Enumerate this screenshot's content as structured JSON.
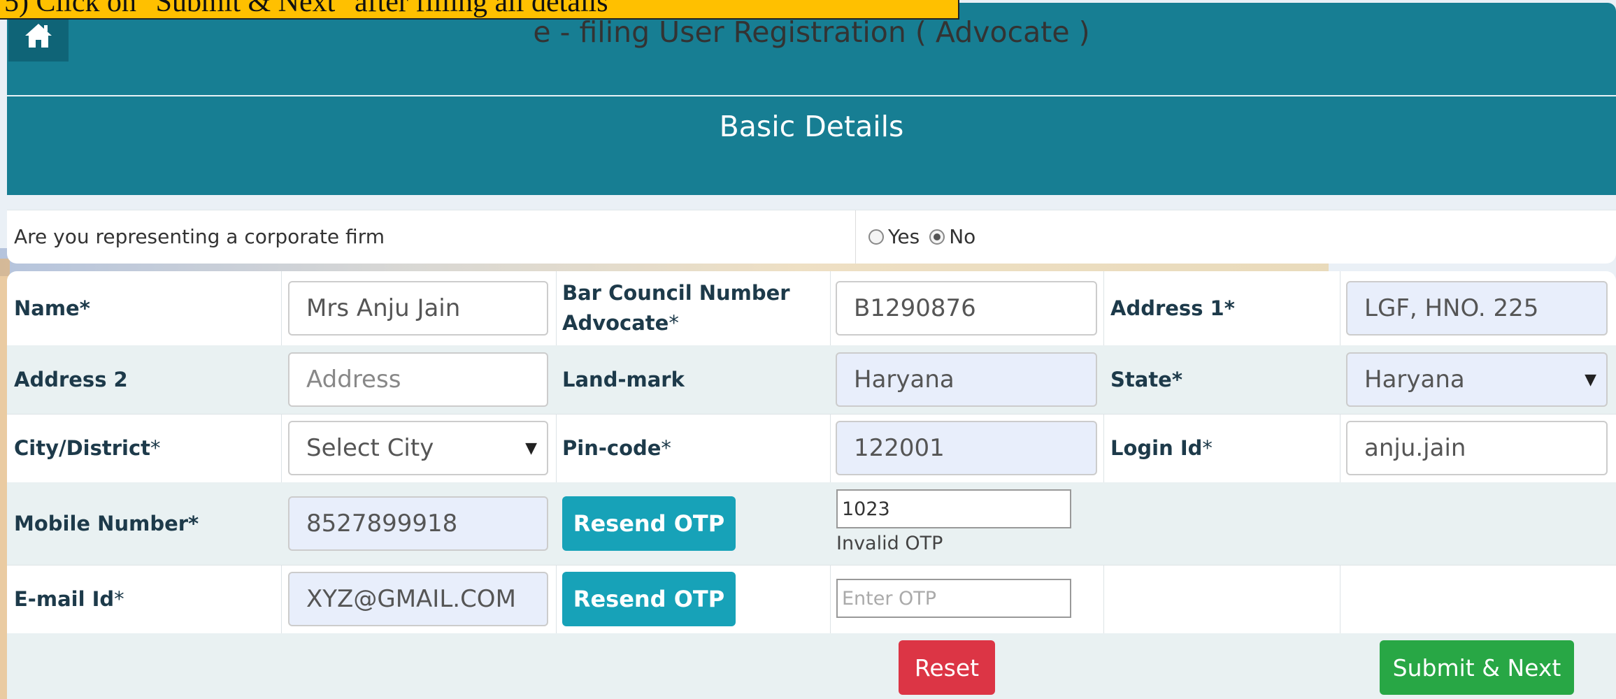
{
  "instruction": "5) Click on \"Submit & Next\" after filling all details",
  "header": {
    "title": "e - filing User Registration ( Advocate )",
    "home_icon": "home-icon",
    "section_title": "Basic Details"
  },
  "corporate": {
    "question": "Are you representing a corporate firm",
    "options": [
      {
        "label": "Yes",
        "selected": false
      },
      {
        "label": "No",
        "selected": true
      }
    ]
  },
  "form": {
    "name": {
      "label": "Name*",
      "value": "Mrs Anju Jain"
    },
    "bar_council": {
      "label_line1": "Bar Council Number",
      "label_line2": "Advocate",
      "req": "*",
      "value": "B1290876"
    },
    "address1": {
      "label": "Address 1*",
      "value": "LGF, HNO. 225"
    },
    "address2": {
      "label": "Address 2",
      "placeholder": "Address"
    },
    "landmark": {
      "label": "Land-mark",
      "value": "Haryana"
    },
    "state": {
      "label": "State*",
      "value": "Haryana"
    },
    "city": {
      "label": "City/District",
      "req": "*",
      "value": "Select City"
    },
    "pincode": {
      "label": "Pin-code",
      "req": "*",
      "value": "122001"
    },
    "login": {
      "label": "Login Id",
      "req": "*",
      "value": "anju.jain"
    },
    "mobile": {
      "label": "Mobile Number*",
      "value": "8527899918",
      "resend_label": "Resend OTP",
      "otp_value": "1023",
      "otp_message": "Invalid OTP"
    },
    "email": {
      "label": "E-mail Id",
      "req": "*",
      "value": "XYZ@GMAIL.COM",
      "resend_label": "Resend OTP",
      "otp_placeholder": "Enter OTP"
    },
    "reset_label": "Reset",
    "submit_label": "Submit & Next"
  },
  "colors": {
    "header_bg": "#177e93",
    "instruction_bg": "#ffc000",
    "otp_button": "#17a2b8",
    "reset_button": "#dc3545",
    "submit_button": "#28a745"
  }
}
